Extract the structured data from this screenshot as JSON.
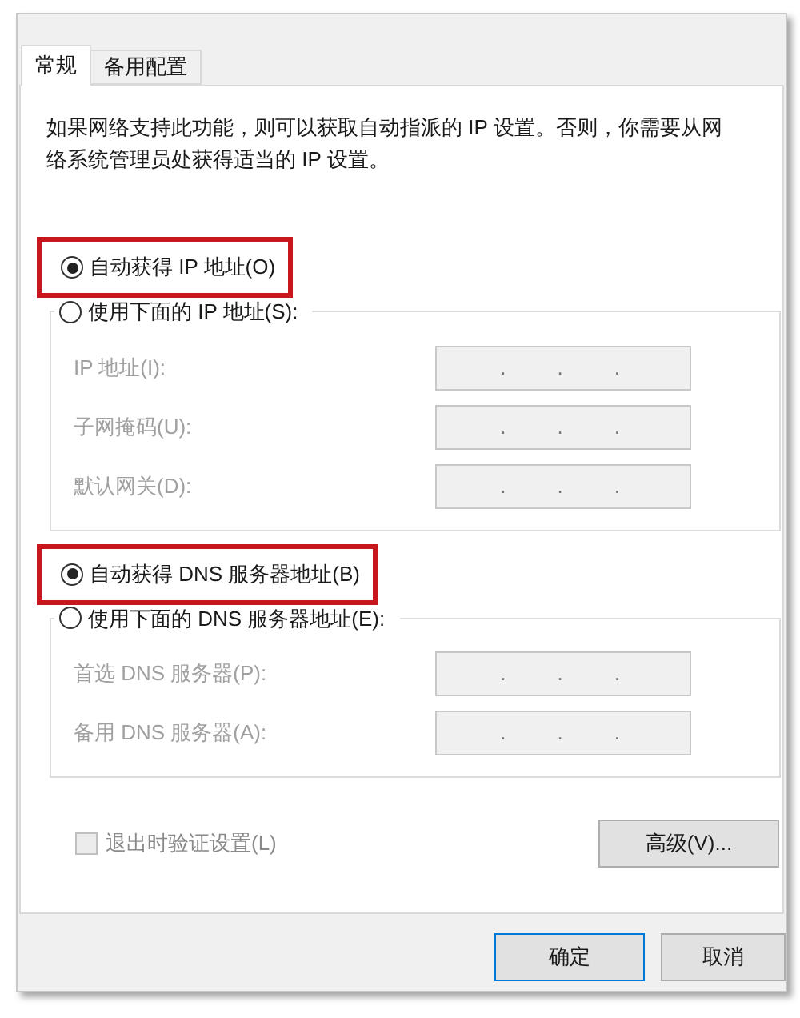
{
  "tabs": [
    {
      "label": "常规",
      "selected": true
    },
    {
      "label": "备用配置",
      "selected": false
    }
  ],
  "description": "如果网络支持此功能，则可以获取自动指派的 IP 设置。否则，你需要从网络系统管理员处获得适当的 IP 设置。",
  "ip_options": [
    {
      "label": "自动获得 IP 地址(O)",
      "selected": true,
      "highlighted": true
    },
    {
      "label": "使用下面的 IP 地址(S):",
      "selected": false,
      "highlighted": false
    }
  ],
  "ip_fields": [
    {
      "label": "IP 地址(I):",
      "disabled": true,
      "separators": [
        ".",
        ".",
        "."
      ]
    },
    {
      "label": "子网掩码(U):",
      "disabled": true,
      "separators": [
        ".",
        ".",
        "."
      ]
    },
    {
      "label": "默认网关(D):",
      "disabled": true,
      "separators": [
        ".",
        ".",
        "."
      ]
    }
  ],
  "dns_options": [
    {
      "label": "自动获得 DNS 服务器地址(B)",
      "selected": true,
      "highlighted": true
    },
    {
      "label": "使用下面的 DNS 服务器地址(E):",
      "selected": false,
      "highlighted": false
    }
  ],
  "dns_fields": [
    {
      "label": "首选 DNS 服务器(P):",
      "disabled": true,
      "separators": [
        ".",
        ".",
        "."
      ]
    },
    {
      "label": "备用 DNS 服务器(A):",
      "disabled": true,
      "separators": [
        ".",
        ".",
        "."
      ]
    }
  ],
  "validate_checkbox": {
    "label": "退出时验证设置(L)",
    "checked": false,
    "disabled": true
  },
  "advanced_button": "高级(V)...",
  "buttons": [
    "确定",
    "取消"
  ]
}
